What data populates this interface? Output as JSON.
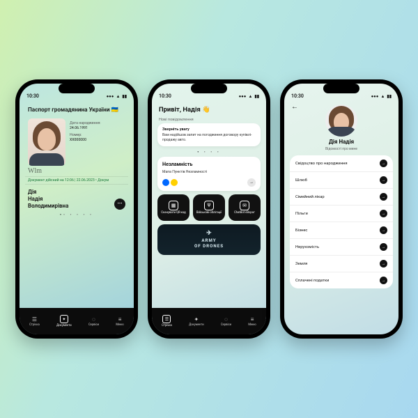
{
  "status": {
    "time": "10:30"
  },
  "phone1": {
    "passport_title": "Паспорт громадянина України 🇺🇦",
    "dob_label": "Дата народження:",
    "dob_value": "24.06.1991",
    "num_label": "Номер:",
    "num_value": "XX000000",
    "signature": "Wlm",
    "validity": "Документ дійсний на 12:06 | 22.06.2023 • Докум",
    "surname": "Дія",
    "name": "Надія",
    "patronymic": "Володимирівна"
  },
  "phone2": {
    "greeting": "Привіт, Надія 👋",
    "new_msgs_label": "Нові повідомлення",
    "notice_title": "Зверніть увагу",
    "notice_body": "Вам надійшов запит на погодження договору купівлі-продажу авто.",
    "invinc_title": "Незламність",
    "invinc_sub": "Мапа Пунктів Незламності",
    "tiles": {
      "qr": "Сканувати QR-код",
      "bonds": "Військові облігації",
      "chatbot": "ChatBot єВорог"
    },
    "banner_l1": "ARMY",
    "banner_l2": "OF DRONES"
  },
  "phone3": {
    "name": "Дія Надія",
    "subtitle": "Відомості про мене",
    "items": [
      "Свідоцтво про народження",
      "Шлюб",
      "Сімейний лікар",
      "Пільги",
      "Бізнес",
      "Нерухомість",
      "Земля",
      "Сплачені податки"
    ]
  },
  "nav": {
    "feed": "Стрічка",
    "docs": "Документи",
    "services": "Сервіси",
    "menu": "Меню"
  }
}
